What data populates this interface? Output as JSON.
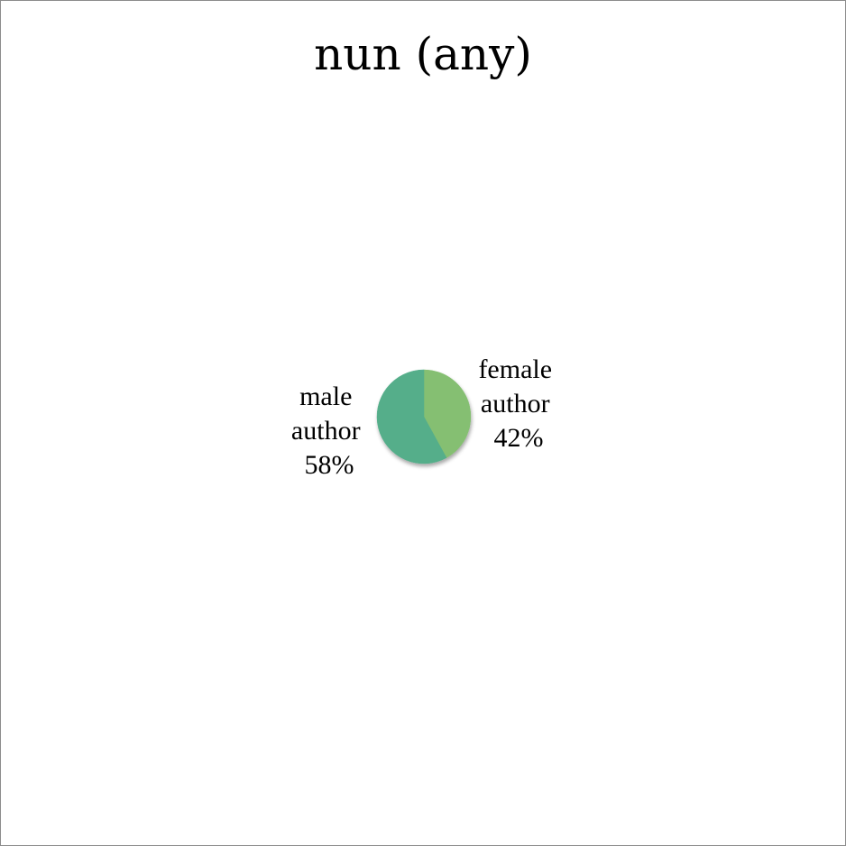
{
  "chart_data": {
    "type": "pie",
    "title": "nun (any)",
    "slices": [
      {
        "label_lines": [
          "female",
          "author"
        ],
        "percent_label": "42%",
        "value": 42,
        "color": "#85BF72"
      },
      {
        "label_lines": [
          "male",
          "author"
        ],
        "percent_label": "58%",
        "value": 58,
        "color": "#54AE8A"
      }
    ],
    "start_angle_deg": 0,
    "direction": "clockwise",
    "legend": "none"
  }
}
